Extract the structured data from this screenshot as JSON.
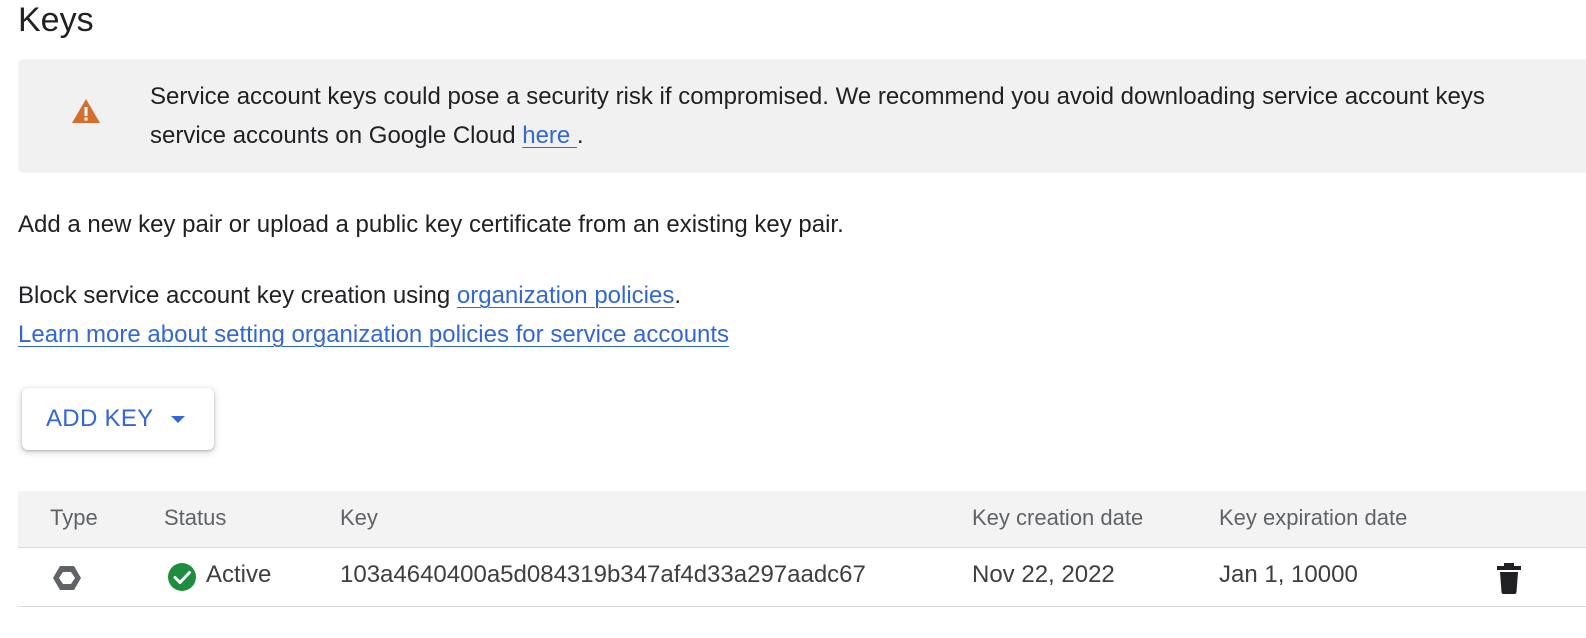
{
  "section": {
    "title": "Keys"
  },
  "banner": {
    "icon": "warning-icon",
    "icon_color": "#d56e2c",
    "line1": "Service account keys could pose a security risk if compromised. We recommend you avoid downloading service account keys",
    "line2_prefix": "service accounts on Google Cloud ",
    "link": "here ",
    "line2_suffix": "."
  },
  "intro": {
    "text": "Add a new key pair or upload a public key certificate from an existing key pair."
  },
  "policy": {
    "prefix": "Block service account key creation using ",
    "link": "organization policies",
    "suffix": ".",
    "learn_more": "Learn more about setting organization policies for service accounts"
  },
  "add_key": {
    "label": "ADD KEY",
    "icon": "caret-down-icon"
  },
  "table": {
    "headers": [
      "Type",
      "Status",
      "Key",
      "Key creation date",
      "Key expiration date"
    ],
    "rows": [
      {
        "type_icon": "hexagon-key-icon",
        "status": "Active",
        "status_icon": "check-circle-icon",
        "status_color": "#1e8e3e",
        "key": "103a4640400a5d084319b347af4d33a297aadc67",
        "created": "Nov 22, 2022",
        "expires": "Jan 1, 10000",
        "action_icon": "delete-icon"
      }
    ]
  },
  "colors": {
    "link": "#3367d6",
    "banner_bg": "#f1f1f1",
    "header_bg": "#f3f3f3"
  }
}
